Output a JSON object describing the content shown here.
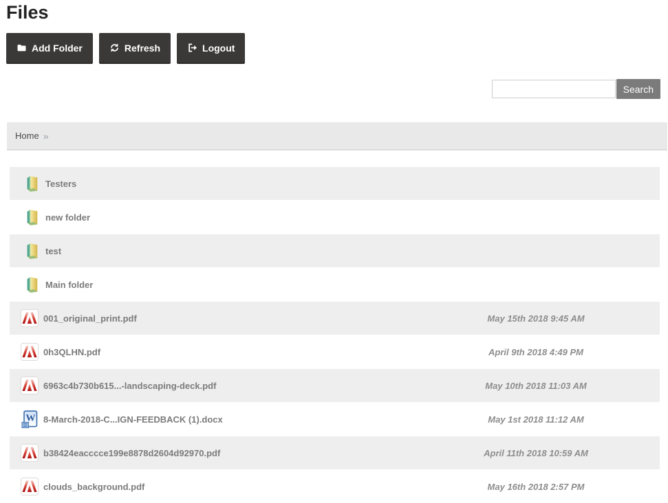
{
  "page": {
    "title": "Files"
  },
  "toolbar": {
    "add_folder_label": "Add Folder",
    "refresh_label": "Refresh",
    "logout_label": "Logout"
  },
  "search": {
    "value": "",
    "placeholder": "",
    "button_label": "Search"
  },
  "breadcrumb": {
    "home_label": "Home",
    "separator": "»"
  },
  "files": {
    "rows": [
      {
        "type": "folder",
        "name": "Testers",
        "date": ""
      },
      {
        "type": "folder",
        "name": "new folder",
        "date": ""
      },
      {
        "type": "folder",
        "name": "test",
        "date": ""
      },
      {
        "type": "folder",
        "name": "Main folder",
        "date": ""
      },
      {
        "type": "pdf",
        "name": "001_original_print.pdf",
        "date": "May 15th 2018 9:45 AM"
      },
      {
        "type": "pdf",
        "name": "0h3QLHN.pdf",
        "date": "April 9th 2018 4:49 PM"
      },
      {
        "type": "pdf",
        "name": "6963c4b730b615...-landscaping-deck.pdf",
        "date": "May 10th 2018 11:03 AM"
      },
      {
        "type": "docx",
        "name": "8-March-2018-C...IGN-FEEDBACK (1).docx",
        "date": "May 1st 2018 11:12 AM"
      },
      {
        "type": "pdf",
        "name": "b38424eacccce199e8878d2604d92970.pdf",
        "date": "April 11th 2018 10:59 AM"
      },
      {
        "type": "pdf",
        "name": "clouds_background.pdf",
        "date": "May 16th 2018 2:57 PM"
      }
    ]
  },
  "colors": {
    "button_bg": "#3b3938",
    "search_button_bg": "#7b7b7b",
    "breadcrumb_bg": "#e9e9e9",
    "row_stripe": "#eeeeee",
    "name_text": "#7b7b7b",
    "date_text": "#8d8d8d",
    "pdf_icon_red": "#b50f0f",
    "word_icon_blue": "#3a6fb0",
    "folder_icon_yellow": "#ddc15c",
    "folder_icon_green": "#3f9f8a"
  }
}
